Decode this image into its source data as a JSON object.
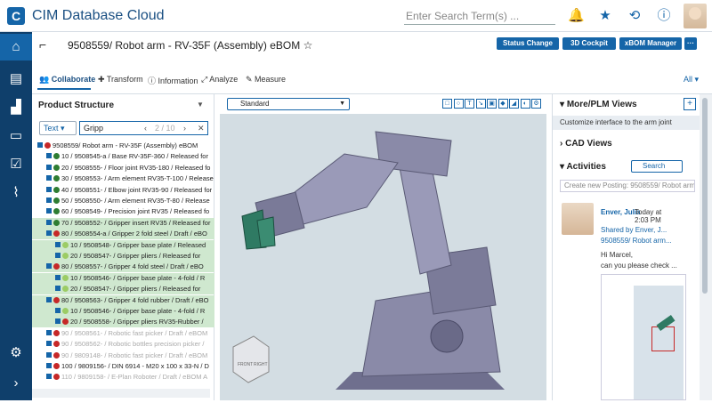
{
  "app": {
    "title": "CIM Database Cloud",
    "logo": "C"
  },
  "search": {
    "placeholder": "Enter Search Term(s) ..."
  },
  "top_icons": [
    "bell-icon",
    "star-icon",
    "history-icon",
    "info-icon"
  ],
  "sidebar": [
    "home-icon",
    "document-icon",
    "parts-icon",
    "projects-icon",
    "tasks-icon",
    "analytics-icon",
    "settings-icon",
    "expand-icon"
  ],
  "header": {
    "title": "9508559/ Robot arm - RV-35F (Assembly) eBOM",
    "star": "☆",
    "buttons": {
      "status": "Status Change",
      "cockpit": "3D Cockpit",
      "xbom": "xBOM Manager",
      "more": "···"
    },
    "tabs": [
      "Collaborate",
      "Transform",
      "Information",
      "Analyze",
      "Measure"
    ],
    "all_label": "All ▾"
  },
  "product_structure": {
    "title": "Product Structure",
    "filter_type": "Text",
    "filter_value": "Gripp",
    "counter": "2 / 10",
    "rows": [
      {
        "text": "9508559/ Robot arm - RV-35F (Assembly) eBOM",
        "color": "#c62828",
        "indent": 0,
        "hl": false,
        "dim": false
      },
      {
        "text": "10 / 9508545-a / Base RV-35F-360 / Released for",
        "color": "#2e7d32",
        "indent": 1,
        "hl": false,
        "dim": false
      },
      {
        "text": "20 / 9508555- / Floor joint RV35-180 / Released fo",
        "color": "#2e7d32",
        "indent": 1,
        "hl": false,
        "dim": false
      },
      {
        "text": "30 / 9508553- / Arm element RV35-T-100 / Release",
        "color": "#2e7d32",
        "indent": 1,
        "hl": false,
        "dim": false
      },
      {
        "text": "40 / 9508551- / Elbow joint RV35-90 / Released for",
        "color": "#2e7d32",
        "indent": 1,
        "hl": false,
        "dim": false
      },
      {
        "text": "50 / 9508550- / Arm element RV35-T-80 / Release",
        "color": "#2e7d32",
        "indent": 1,
        "hl": false,
        "dim": false
      },
      {
        "text": "60 / 9508549- / Precision joint RV35 / Released fo",
        "color": "#2e7d32",
        "indent": 1,
        "hl": false,
        "dim": false
      },
      {
        "text": "70 / 9508552- / Gripper insert RV35 / Released for",
        "color": "#2e7d32",
        "indent": 1,
        "hl": true,
        "dim": false
      },
      {
        "text": "80 / 9508554-a / Gripper 2 fold steel / Draft / eBO",
        "color": "#c62828",
        "indent": 1,
        "hl": true,
        "dim": false
      },
      {
        "text": "10 / 9508548- / Gripper base plate / Released",
        "color": "#9ccc65",
        "indent": 2,
        "hl": true,
        "dim": false
      },
      {
        "text": "20 / 9508547- / Gripper pliers / Released for",
        "color": "#9ccc65",
        "indent": 2,
        "hl": true,
        "dim": false
      },
      {
        "text": "80 / 9508557- / Gripper 4 fold steel / Draft / eBO",
        "color": "#c62828",
        "indent": 1,
        "hl": true,
        "dim": false
      },
      {
        "text": "10 / 9508546- / Gripper base plate - 4-fold / R",
        "color": "#9ccc65",
        "indent": 2,
        "hl": true,
        "dim": false
      },
      {
        "text": "20 / 9508547- / Gripper pliers / Released for",
        "color": "#9ccc65",
        "indent": 2,
        "hl": true,
        "dim": false
      },
      {
        "text": "80 / 9508563- / Gripper 4 fold rubber / Draft / eBO",
        "color": "#c62828",
        "indent": 1,
        "hl": true,
        "dim": false
      },
      {
        "text": "10 / 9508546- / Gripper base plate - 4-fold / R",
        "color": "#9ccc65",
        "indent": 2,
        "hl": true,
        "dim": false
      },
      {
        "text": "20 / 9508558- / Gripper pliers RV35-Rubber /",
        "color": "#c62828",
        "indent": 2,
        "hl": true,
        "dim": false
      },
      {
        "text": "90 / 9508561- / Robotic fast picker / Draft / eBOM",
        "color": "#c62828",
        "indent": 1,
        "hl": false,
        "dim": true
      },
      {
        "text": "90 / 9508562- / Robotic bottles precision picker /",
        "color": "#c62828",
        "indent": 1,
        "hl": false,
        "dim": true
      },
      {
        "text": "90 / 9809148- / Robotic fast picker / Draft / eBOM",
        "color": "#c62828",
        "indent": 1,
        "hl": false,
        "dim": true
      },
      {
        "text": "100 / 9809156- / DIN 6914 - M20 x 100 x 33-N / D",
        "color": "#c62828",
        "indent": 1,
        "hl": false,
        "dim": false
      },
      {
        "text": "110 / 9809158- / E-Plan Roboter / Draft / eBOM A",
        "color": "#c62828",
        "indent": 1,
        "hl": false,
        "dim": true
      }
    ]
  },
  "viewer": {
    "view_label": "Standard",
    "tools": [
      "□",
      "○",
      "T",
      "↘",
      "▣",
      "◆",
      "◢",
      "◐",
      "⚙"
    ],
    "cube_labels": [
      "FRONT",
      "RIGHT"
    ]
  },
  "right": {
    "more_plm": "More/PLM Views",
    "customize": "Customize interface to the arm joint",
    "cad": "CAD Views",
    "activities": "Activities",
    "search_btn": "Search",
    "posting_placeholder": "Create new Posting: 9508559/ Robot arm - R",
    "post": {
      "author": "Enver, Julia",
      "time": "Today at 2:03 PM",
      "shared": "Shared by Enver, J...",
      "object": "9508559/ Robot arm...",
      "greeting": "Hi Marcel,",
      "body": "can you please check ..."
    }
  },
  "colors": {
    "accent": "#1565a8",
    "sidebar": "#0f3f6b",
    "highlight": "#cfe8cf",
    "robot": "#8a8aa8"
  }
}
